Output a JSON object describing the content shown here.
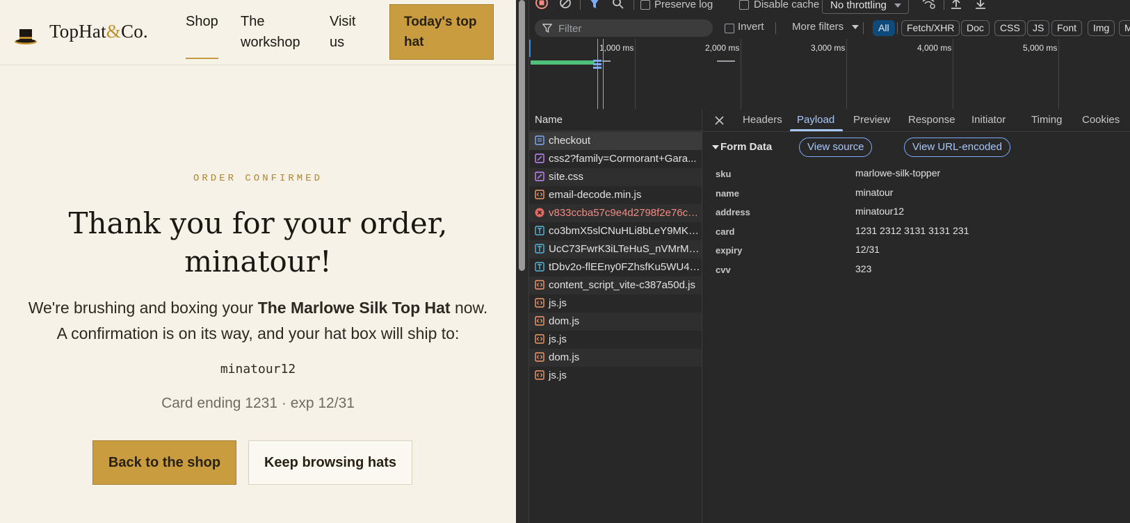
{
  "site": {
    "logo": {
      "brand": "TopHat",
      "amp": "&",
      "suffix": "Co."
    },
    "nav": {
      "items": [
        {
          "label": "Shop"
        },
        {
          "label": "The workshop"
        },
        {
          "label": "Visit us"
        }
      ],
      "cta": "Today's top hat"
    },
    "confirmation": {
      "eyebrow": "ORDER CONFIRMED",
      "title": "Thank you for your order, minatour!",
      "line1_prefix": "We're brushing and boxing your ",
      "product_name": "The Marlowe Silk Top Hat",
      "line1_suffix": " now.",
      "line2": "A confirmation is on its way, and your hat box will ship to:",
      "address": "minatour12",
      "card_line": "Card ending 1231 · exp 12/31",
      "primary_button": "Back to the shop",
      "secondary_button": "Keep browsing hats"
    }
  },
  "devtools": {
    "toolbar": {
      "preserve_log": "Preserve log",
      "disable_cache": "Disable cache",
      "throttling": "No throttling"
    },
    "filter_bar": {
      "placeholder": "Filter",
      "invert": "Invert",
      "more_filters": "More filters",
      "types": [
        "All",
        "Fetch/XHR",
        "Doc",
        "CSS",
        "JS",
        "Font",
        "Img",
        "Me"
      ],
      "active_type": "All"
    },
    "timeline": {
      "ticks": [
        "1,000 ms",
        "2,000 ms",
        "3,000 ms",
        "4,000 ms",
        "5,000 ms"
      ]
    },
    "requests": {
      "column": "Name",
      "rows": [
        {
          "name": "checkout",
          "icon": "document-icon"
        },
        {
          "name": "css2?family=Cormorant+Gara...",
          "icon": "stylesheet-icon"
        },
        {
          "name": "site.css",
          "icon": "stylesheet-icon"
        },
        {
          "name": "email-decode.min.js",
          "icon": "script-icon"
        },
        {
          "name": "v833ccba57c9e4d2798f2e76ce...",
          "icon": "error-icon"
        },
        {
          "name": "co3bmX5slCNuHLi8bLeY9MK7...",
          "icon": "text-icon"
        },
        {
          "name": "UcC73FwrK3iLTeHuS_nVMrMx...",
          "icon": "text-icon"
        },
        {
          "name": "tDbv2o-flEEny0FZhsfKu5WU4z...",
          "icon": "text-icon"
        },
        {
          "name": "content_script_vite-c387a50d.js",
          "icon": "script-icon"
        },
        {
          "name": "js.js",
          "icon": "script-icon"
        },
        {
          "name": "dom.js",
          "icon": "script-icon"
        },
        {
          "name": "js.js",
          "icon": "script-icon"
        },
        {
          "name": "dom.js",
          "icon": "script-icon"
        },
        {
          "name": "js.js",
          "icon": "script-icon"
        }
      ]
    },
    "detail": {
      "tabs": [
        "Headers",
        "Payload",
        "Preview",
        "Response",
        "Initiator",
        "Timing",
        "Cookies"
      ],
      "active_tab": "Payload",
      "form_data_title": "Form Data",
      "view_source": "View source",
      "view_url_encoded": "View URL-encoded",
      "fields": [
        {
          "key": "sku",
          "value": "marlowe-silk-topper"
        },
        {
          "key": "name",
          "value": "minatour"
        },
        {
          "key": "address",
          "value": "minatour12"
        },
        {
          "key": "card",
          "value": "1231 2312 3131 3131 231"
        },
        {
          "key": "expiry",
          "value": "12/31"
        },
        {
          "key": "cvv",
          "value": "323"
        }
      ]
    }
  }
}
